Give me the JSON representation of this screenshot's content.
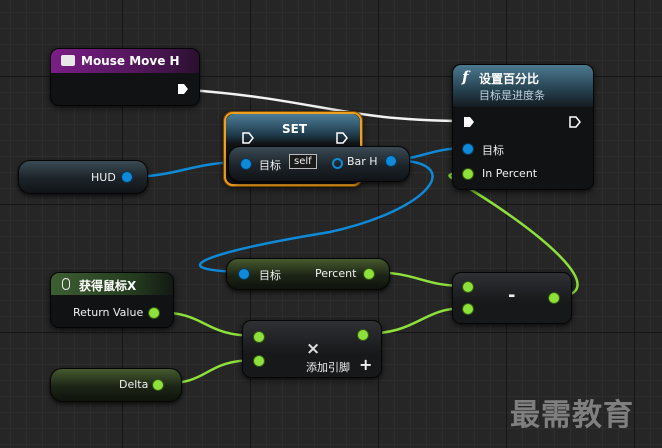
{
  "event_node": {
    "title": "Mouse Move H"
  },
  "set_node": {
    "title": "SET",
    "target_label": "目标",
    "self_label": "self",
    "output_label": "Bar H"
  },
  "hud_var": {
    "label": "HUD"
  },
  "percent_node": {
    "title": "设置百分比",
    "subtitle": "目标是进度条",
    "target_label": "目标",
    "percent_label": "In Percent"
  },
  "get_mouse_node": {
    "title": "获得鼠标X",
    "output_label": "Return Value"
  },
  "get_percent_node": {
    "target_label": "目标",
    "output_label": "Percent"
  },
  "subtract_node": {
    "symbol": "-"
  },
  "multiply_node": {
    "symbol": "×",
    "add_pin_label": "添加引脚",
    "add_symbol": "+"
  },
  "delta_var": {
    "label": "Delta"
  },
  "watermark": {
    "text": "最需教育"
  },
  "colors": {
    "event_header": "#7a1e86",
    "function_header": "#3e6a82",
    "exec_wire": "#f2f2f2",
    "object_wire": "#0f8ad8",
    "float_wire": "#8ee03a",
    "selection": "#f0a020"
  }
}
